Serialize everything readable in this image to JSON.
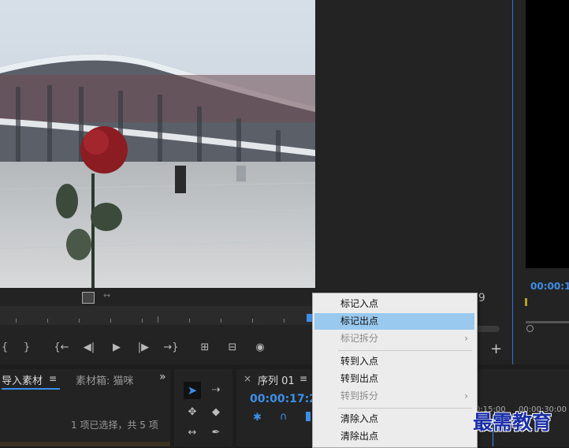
{
  "source_monitor": {
    "frame_counter_suffix": "19",
    "transport_icons": [
      "mark-in-icon",
      "mark-out-icon",
      "go-to-in-icon",
      "step-back-icon",
      "play-icon",
      "step-forward-icon",
      "go-to-out-icon",
      "insert-icon",
      "overwrite-icon",
      "export-frame-icon"
    ]
  },
  "program_monitor": {
    "timecode": "00:00:1"
  },
  "project_panel": {
    "tab_import": "导入素材",
    "tab_bin": "素材箱: 猫咪",
    "status": "1 项已选择，共 5 项",
    "more": "»"
  },
  "timeline": {
    "close": "×",
    "tab_label": "序列 01",
    "timecode": "00:00:17:2",
    "ruler_labels": [
      "0:15:00",
      "00:00:30:00"
    ]
  },
  "context_menu": {
    "items": [
      {
        "label": "标记入点",
        "enabled": true,
        "highlighted": false,
        "submenu": false
      },
      {
        "label": "标记出点",
        "enabled": true,
        "highlighted": true,
        "submenu": false
      },
      {
        "label": "标记拆分",
        "enabled": false,
        "highlighted": false,
        "submenu": true
      },
      {
        "label": "转到入点",
        "enabled": true,
        "highlighted": false,
        "submenu": false
      },
      {
        "label": "转到出点",
        "enabled": true,
        "highlighted": false,
        "submenu": false
      },
      {
        "label": "转到拆分",
        "enabled": false,
        "highlighted": false,
        "submenu": true
      },
      {
        "label": "清除入点",
        "enabled": true,
        "highlighted": false,
        "submenu": false
      },
      {
        "label": "清除出点",
        "enabled": true,
        "highlighted": false,
        "submenu": false
      }
    ],
    "submenu_arrow": "›"
  },
  "watermark": "最需教育",
  "colors": {
    "accent_blue": "#2b6fd8",
    "timecode_blue": "#3d8ee6",
    "menu_highlight": "#99c9ef",
    "panel_bg": "#232323"
  }
}
